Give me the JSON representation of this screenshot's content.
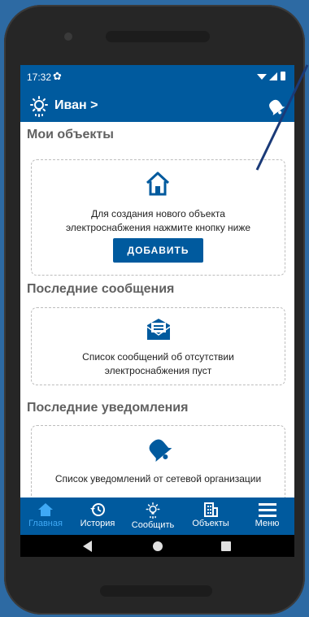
{
  "status": {
    "time": "17:32"
  },
  "header": {
    "user_name": "Иван >"
  },
  "sections": {
    "objects": {
      "title": "Мои объекты",
      "empty_line1": "Для создания нового объекта",
      "empty_line2": "электроснабжения нажмите кнопку ниже",
      "add_label": "ДОБАВИТЬ"
    },
    "messages": {
      "title": "Последние сообщения",
      "empty_line1": "Список сообщений об отсутствии",
      "empty_line2": "электроснабжения пуст"
    },
    "notifications": {
      "title": "Последние уведомления",
      "empty_line1": "Список уведомлений от сетевой организации"
    }
  },
  "nav": {
    "items": [
      {
        "label": "Главная",
        "icon": "home-icon",
        "active": true
      },
      {
        "label": "История",
        "icon": "history-icon",
        "active": false
      },
      {
        "label": "Сообщить",
        "icon": "report-bulb-icon",
        "active": false
      },
      {
        "label": "Объекты",
        "icon": "building-icon",
        "active": false
      },
      {
        "label": "Меню",
        "icon": "menu-icon",
        "active": false
      }
    ]
  },
  "colors": {
    "primary": "#005a9e",
    "active_nav": "#3fa9f5",
    "background": "#2d6aa3"
  }
}
